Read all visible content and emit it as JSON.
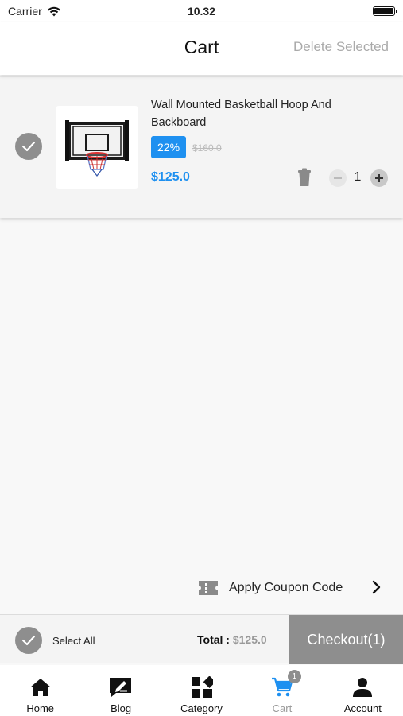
{
  "status_bar": {
    "carrier": "Carrier",
    "time": "10.32"
  },
  "header": {
    "title": "Cart",
    "delete_selected": "Delete Selected"
  },
  "cart_items": [
    {
      "name": "Wall Mounted Basketball Hoop And Backboard",
      "discount": "22%",
      "original_price": "$160.0",
      "price": "$125.0",
      "quantity": "1",
      "selected": true
    }
  ],
  "coupon": {
    "label": "Apply Coupon Code"
  },
  "footer": {
    "select_all": "Select All",
    "total_label": "Total :",
    "total_value": "$125.0",
    "checkout": "Checkout(1)"
  },
  "tabs": [
    {
      "label": "Home",
      "icon": "home-icon"
    },
    {
      "label": "Blog",
      "icon": "blog-icon"
    },
    {
      "label": "Category",
      "icon": "category-icon"
    },
    {
      "label": "Cart",
      "icon": "cart-icon",
      "badge": "1",
      "active": true
    },
    {
      "label": "Account",
      "icon": "account-icon"
    }
  ],
  "colors": {
    "accent": "#1e90f0",
    "muted": "#8e8e8e",
    "background": "#f8f8f8"
  }
}
